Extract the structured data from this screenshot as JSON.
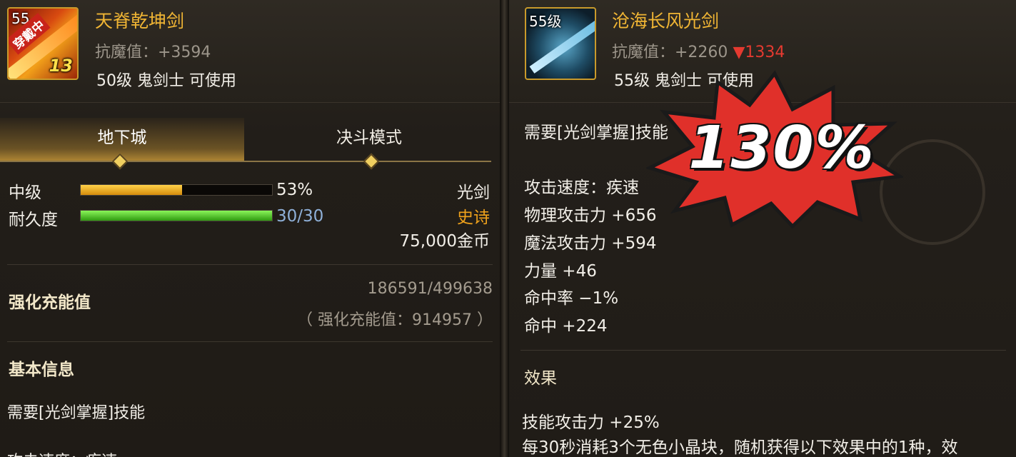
{
  "left": {
    "item": {
      "icon_level": "55",
      "equipped_tag": "穿戴中",
      "enhance": "13",
      "name": "天脊乾坤剑",
      "magic_resist": "抗魔值：+3594",
      "requirement": "50级 鬼剑士 可使用"
    },
    "tabs": [
      {
        "label": "地下城",
        "active": true
      },
      {
        "label": "决斗模式",
        "active": false
      }
    ],
    "stats": {
      "grade_label": "中级",
      "grade_percent": "53%",
      "grade_fill": 0.53,
      "durability_label": "耐久度",
      "durability_value": "30/30",
      "durability_fill": 1.0,
      "weapon_type": "光剑",
      "rarity": "史诗",
      "price": "75,000金币"
    },
    "enhance_energy": {
      "title": "强化充能值",
      "progress": "186591/499638",
      "total": "（ 强化充能值：914957 ）"
    },
    "basic_info": {
      "title": "基本信息",
      "skill_req": "需要[光剑掌握]技能",
      "cut_line": "攻击速度：疾速"
    }
  },
  "right": {
    "item": {
      "icon_level": "55级",
      "name": "沧海长风光剑",
      "magic_resist": "抗魔值：+2260",
      "magic_resist_diff": "▼1334",
      "requirement": "55级 鬼剑士 可使用"
    },
    "skill_req": "需要[光剑掌握]技能",
    "attributes": [
      "攻击速度：疾速",
      "物理攻击力 +656",
      "魔法攻击力 +594",
      "力量 +46",
      "命中率 −1%",
      "命中 +224"
    ],
    "effects_title": "效果",
    "effects": [
      "技能攻击力 +25%",
      "每30秒消耗3个无色小晶块，随机获得以下效果中的1种，效"
    ]
  },
  "overlay": {
    "burst_text": "130%",
    "burst_color": "#e0302a"
  },
  "colors": {
    "gold_name": "#f0b534",
    "epic": "#f0a21b",
    "durability_text": "#8fb0d8",
    "grade_bar": "#f2b318",
    "durability_bar": "#5fd22a",
    "down": "#e43a30"
  }
}
